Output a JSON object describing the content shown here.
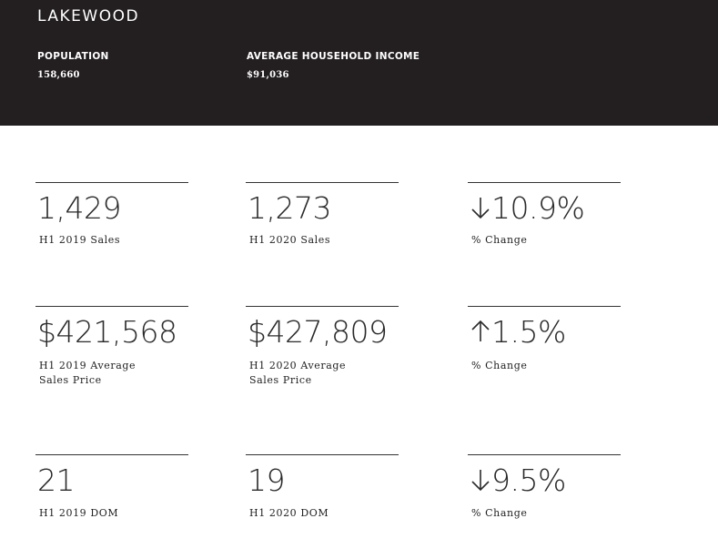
{
  "header": {
    "city": "LAKEWOOD",
    "population_label": "POPULATION",
    "population_value": "158,660",
    "income_label": "AVERAGE HOUSEHOLD INCOME",
    "income_value": "$91,036"
  },
  "rows": [
    {
      "h1_2019": {
        "value": "1,429",
        "caption": "H1 2019 Sales"
      },
      "h1_2020": {
        "value": "1,273",
        "caption": "H1 2020 Sales"
      },
      "change": {
        "direction": "down",
        "value": "10.9%",
        "caption": "% Change",
        "arrow_icon": "arrow-down-icon"
      }
    },
    {
      "h1_2019": {
        "value": "$421,568",
        "caption": "H1 2019 Average\nSales Price"
      },
      "h1_2020": {
        "value": "$427,809",
        "caption": "H1 2020 Average\nSales Price"
      },
      "change": {
        "direction": "up",
        "value": "1.5%",
        "caption": "% Change",
        "arrow_icon": "arrow-up-icon"
      }
    },
    {
      "h1_2019": {
        "value": "21",
        "caption": "H1 2019 DOM"
      },
      "h1_2020": {
        "value": "19",
        "caption": "H1 2020 DOM"
      },
      "change": {
        "direction": "down",
        "value": "9.5%",
        "caption": "% Change",
        "arrow_icon": "arrow-down-icon"
      }
    }
  ],
  "colors": {
    "header_bg": "#231f20",
    "header_text": "#ffffff",
    "body_text": "#222222"
  }
}
